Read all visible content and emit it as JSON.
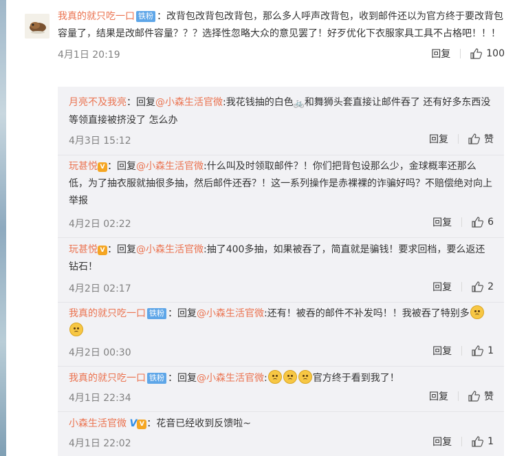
{
  "main_comment": {
    "user": "我真的就只吃一口",
    "badge": "铁粉",
    "text": "：改背包改背包改背包，那么多人呼声改背包，收到邮件还以为官方终于要改背包容量了，结果是改邮件容量？？？选择性忽略大众的意见罢了！好歹优化下衣服家具工具不占格吧！！！",
    "time": "4月1日 20:19",
    "reply_label": "回复",
    "likes": "100"
  },
  "replies": [
    {
      "user": "月亮不及我亮",
      "prefix": "：回复",
      "mention": "@小森生活官微",
      "text_before": ":我花钱抽的白色",
      "text_after": "和舞狮头套直接让邮件吞了 还有好多东西没等领直接被挤没了 怎么办",
      "time": "4月3日 15:12",
      "reply_label": "回复",
      "likes": "赞"
    },
    {
      "user": "玩甚悦",
      "prefix": "：回复",
      "mention": "@小森生活官微",
      "text": ":什么叫及时领取邮件？！你们把背包设那么少，金球概率还那么低，为了抽衣服就抽很多抽，然后邮件还吞？！这一系列操作是赤裸裸的诈骗好吗？不赔偿绝对向上举报",
      "time": "4月2日 02:22",
      "reply_label": "回复",
      "likes": "6"
    },
    {
      "user": "玩甚悦",
      "prefix": "：回复",
      "mention": "@小森生活官微",
      "text": ":抽了400多抽，如果被吞了，简直就是骗钱！要求回档，要么返还钻石！",
      "time": "4月2日 02:17",
      "reply_label": "回复",
      "likes": "2"
    },
    {
      "user": "我真的就只吃一口",
      "badge": "铁粉",
      "prefix": "：回复",
      "mention": "@小森生活官微",
      "text": ":还有！被吞的邮件不补发吗！！我被吞了特别多",
      "time": "4月2日 00:30",
      "reply_label": "回复",
      "likes": "1"
    },
    {
      "user": "我真的就只吃一口",
      "badge": "铁粉",
      "prefix": "：回复",
      "mention": "@小森生活官微",
      "text_before": ":",
      "text_after": "官方终于看到我了！",
      "time": "4月1日 22:34",
      "reply_label": "回复",
      "likes": "赞"
    },
    {
      "user": "小森生活官微",
      "verified": "V",
      "prefix": "：",
      "text": "花音已经收到反馈啦~",
      "time": "4月1日 22:02",
      "reply_label": "回复",
      "likes": "1"
    }
  ],
  "icons": [
    "thumbs-up-icon",
    "sad-emoji-icon",
    "bicycle-icon",
    "vip-badge-icon",
    "verified-icon"
  ],
  "colors": {
    "username": "#eb7350",
    "badge": "#5ea6e8",
    "reply_bg": "#f2f2f5"
  }
}
